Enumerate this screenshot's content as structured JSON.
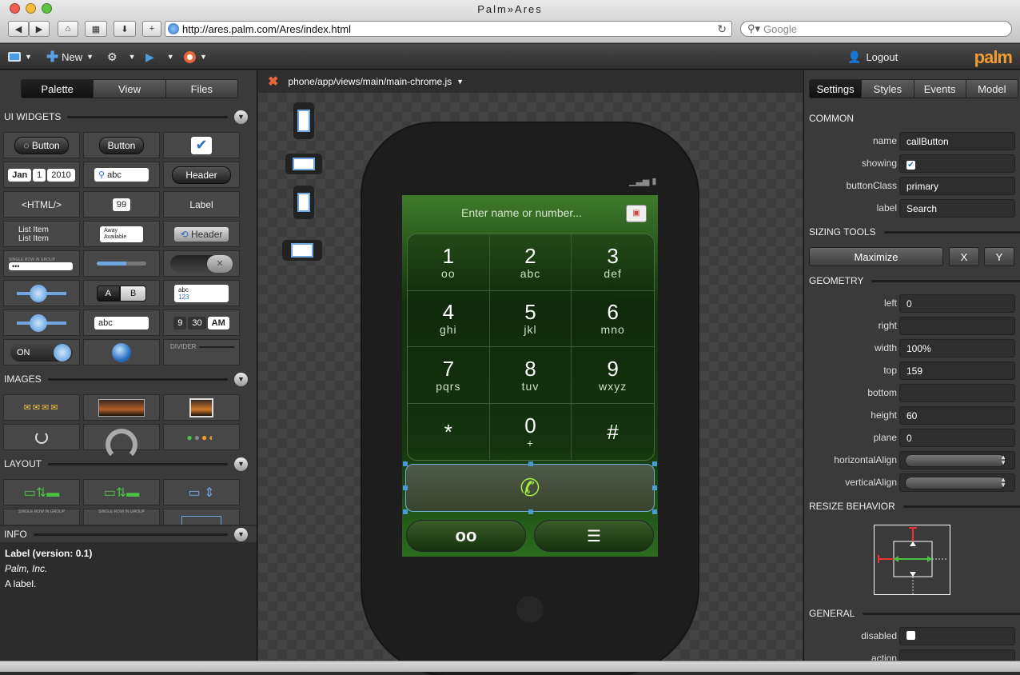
{
  "browser": {
    "window_title": "Palm»Ares",
    "url": "http://ares.palm.com/Ares/index.html",
    "search_placeholder": "Google"
  },
  "toolbar": {
    "new_label": "New",
    "logout_label": "Logout",
    "brand": "palm"
  },
  "left_panel": {
    "tabs": [
      "Palette",
      "View",
      "Files"
    ],
    "active_tab": "Palette",
    "sections": {
      "ui_widgets": "UI WIDGETS",
      "images": "IMAGES",
      "layout": "LAYOUT",
      "info": "INFO"
    },
    "widgets": {
      "spinner_button": "Button",
      "button": "Button",
      "date_month": "Jan",
      "date_day": "1",
      "date_year": "2010",
      "search_text": "abc",
      "header": "Header",
      "html": "<HTML/>",
      "integer": "99",
      "label": "Label",
      "list_item_1": "List Item",
      "list_item_2": "List Item",
      "list_selector_1": "Away",
      "list_selector_2": "Available",
      "view_header": "Header",
      "group_title": "SINGLE ROW IN GROUP",
      "password": "•••",
      "radio_a": "A",
      "radio_b": "B",
      "rich_text_1": "abc",
      "rich_text_2": "123",
      "input_text": "abc",
      "time_hour": "9",
      "time_min": "30",
      "time_ampm": "AM",
      "toggle_on": "ON",
      "divider": "DIVIDER"
    },
    "layout_group_title": "SINGLE ROW IN GROUP",
    "info": {
      "title": "Label (version: 0.1)",
      "vendor": "Palm, Inc.",
      "description": "A label."
    }
  },
  "center": {
    "file_path": "phone/app/views/main/main-chrome.js",
    "phone": {
      "search_placeholder": "Enter name or number...",
      "keys": [
        {
          "digit": "1",
          "letters": "oo"
        },
        {
          "digit": "2",
          "letters": "abc"
        },
        {
          "digit": "3",
          "letters": "def"
        },
        {
          "digit": "4",
          "letters": "ghi"
        },
        {
          "digit": "5",
          "letters": "jkl"
        },
        {
          "digit": "6",
          "letters": "mno"
        },
        {
          "digit": "7",
          "letters": "pqrs"
        },
        {
          "digit": "8",
          "letters": "tuv"
        },
        {
          "digit": "9",
          "letters": "wxyz"
        },
        {
          "digit": "*",
          "letters": ""
        },
        {
          "digit": "0",
          "letters": "+"
        },
        {
          "digit": "#",
          "letters": ""
        }
      ]
    }
  },
  "right_panel": {
    "tabs": [
      "Settings",
      "Styles",
      "Events",
      "Model"
    ],
    "active_tab": "Settings",
    "sections": {
      "common": "COMMON",
      "sizing": "SIZING TOOLS",
      "geometry": "GEOMETRY",
      "resize": "RESIZE BEHAVIOR",
      "general": "GENERAL"
    },
    "common": {
      "name_label": "name",
      "name_value": "callButton",
      "showing_label": "showing",
      "buttonClass_label": "buttonClass",
      "buttonClass_value": "primary",
      "label_label": "label",
      "label_value": "Search"
    },
    "sizing": {
      "maximize": "Maximize",
      "x": "X",
      "y": "Y"
    },
    "geometry": {
      "left_label": "left",
      "left_value": "0",
      "right_label": "right",
      "right_value": "",
      "width_label": "width",
      "width_value": "100%",
      "top_label": "top",
      "top_value": "159",
      "bottom_label": "bottom",
      "bottom_value": "",
      "height_label": "height",
      "height_value": "60",
      "plane_label": "plane",
      "plane_value": "0",
      "halign_label": "horizontalAlign",
      "valign_label": "verticalAlign"
    },
    "general": {
      "disabled_label": "disabled",
      "action_label": "action"
    }
  }
}
